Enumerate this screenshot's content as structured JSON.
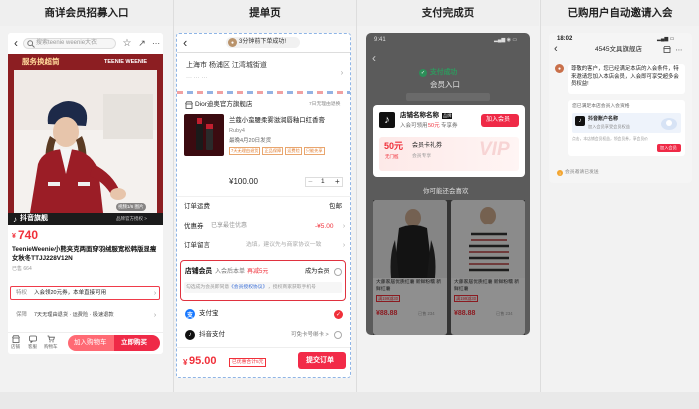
{
  "headers": [
    "商详会员招募入口",
    "提单页",
    "支付完成页",
    "已购用户自动邀请入会"
  ],
  "p1": {
    "search_placeholder": "搜索teenie weenie大衣",
    "banner_left": "服务换超筒",
    "brand": "TEENIE WEENIE",
    "photo_counter": "视频1/6  图片",
    "store": "抖音旗舰",
    "store_tag": "品牌官方授权 >",
    "price_symbol": "¥",
    "price": "740",
    "title": "TeenieWeenie小熊夹克两面穿羽绒服宽松韩版显瘦女秋冬TTJJ228V12N",
    "stock": "已售 664",
    "perk_label": "特权",
    "perk_text": "入会领20元券，本单直接可用",
    "guarantee_label": "保障",
    "guarantee_text": "7天无理由退货 · 运费险 · 极速退款",
    "nav": [
      "店铺",
      "客服",
      "购物车"
    ],
    "btn_cart": "加入购物车",
    "btn_buy": "立即购买"
  },
  "p2": {
    "back": "‹",
    "toast": "3分钟前下单成功!",
    "address_line1": "上海市 杨浦区 江湾城街道",
    "address_line2": "··· ··· ···",
    "store_name": "Dior迪奥官方旗舰店",
    "store_tag": "7日无理由退换",
    "product_title": "兰蔻小蛮腰柔雾滋润唇釉口红香膏",
    "product_spec": "Ruby4",
    "product_ship": "最晚4月20日发货",
    "tags": [
      "7天无理由退货",
      "正品保障",
      "运费险",
      "只能先享"
    ],
    "price": "¥100.00",
    "qty": "1",
    "rows": [
      {
        "label": "订单运费",
        "value": "包邮"
      },
      {
        "label": "优惠券",
        "sub": "已享最佳优惠",
        "value": "-¥5.00"
      },
      {
        "label": "订单留言",
        "sub": "选填，建议先与商家协议一致",
        "value": ""
      }
    ],
    "member_label": "店铺会员",
    "member_sub_prefix": "入会后本单",
    "member_sub_red": "再减5元",
    "member_cta": "成为会员",
    "member_note_prefix": "勾选成为会员即同意",
    "member_note_link": "《会员授权协议》",
    "member_note_suffix": "，授权商家获取手机号",
    "pay1": "支付宝",
    "pay2": "抖音支付",
    "pay2_sub": "可免卡号绑卡 >",
    "total_prefix": "¥",
    "total": "95.00",
    "total_note": "已优惠合计5元",
    "submit": "提交订单"
  },
  "p3": {
    "time": "9:41",
    "pay_success": "支付成功",
    "member_entry_title": "会员入口",
    "back": "‹",
    "store_name": "店铺名称名称",
    "store_badge": "品牌",
    "store_sub_prefix": "入会可领用",
    "store_sub_amount": "50元",
    "store_sub_suffix": "专享券",
    "join": "加入会员",
    "coupon_amount": "50元",
    "coupon_cond": "无门槛",
    "coupon_name": "会员卡礼券",
    "coupon_note": "会员专享",
    "vip": "VIP",
    "rec_title": "你可能还会喜欢",
    "items": [
      {
        "title": "大藤家居优质红薯 新鲜粉糯 新鲜红薯",
        "sub": "满199减30",
        "price": "¥88.88",
        "sold": "已售 234"
      },
      {
        "title": "大藤家居优质红薯 新鲜粉糯 新鲜红薯",
        "sub": "满199减30",
        "price": "¥88.88",
        "sold": "已售 234"
      }
    ]
  },
  "p4": {
    "time": "18:02",
    "title": "4545文具旗舰店",
    "msg": "尊敬的客户，您已经满足本店的入会条件，特来邀请您加入本店会员，入会即可享受超多会员权益!",
    "card_label": "您已满足本店会员入会资格",
    "card_name": "抖音账户名称",
    "card_sub": "加入会员享受会员权益",
    "card_hint": "点击，本店铺会员权益，领会员券，享会员价",
    "card_btn": "加入会员",
    "footer": "会员邀请已发送"
  }
}
